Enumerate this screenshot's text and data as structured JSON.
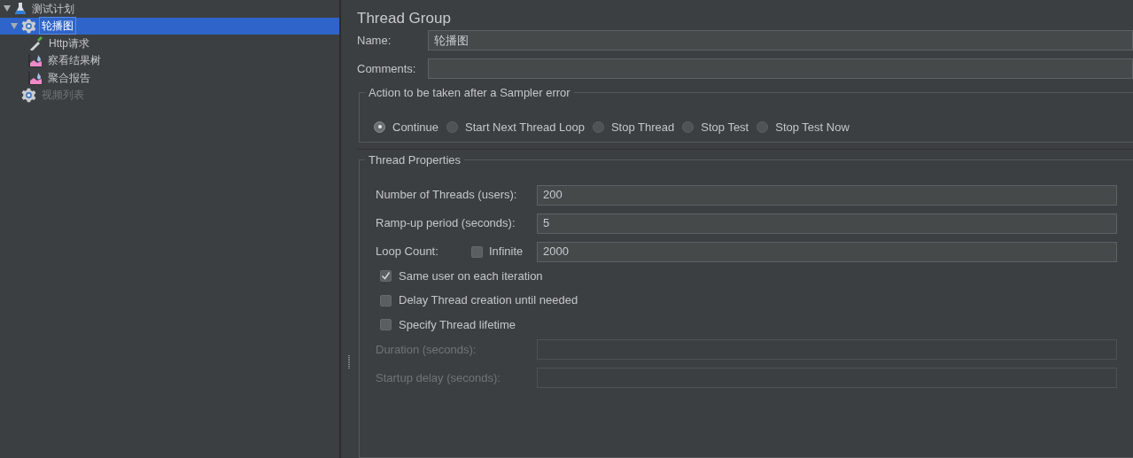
{
  "tree": [
    {
      "label": "测试计划",
      "kind": "flask",
      "expanded": true,
      "selected": false,
      "disabled": false,
      "children": [
        {
          "label": "轮播图",
          "kind": "gear",
          "expanded": true,
          "selected": true,
          "disabled": false,
          "children": [
            {
              "label": "Http请求",
              "kind": "sampler",
              "selected": false,
              "disabled": false
            },
            {
              "label": "察看结果树",
              "kind": "listener",
              "selected": false,
              "disabled": false
            },
            {
              "label": "聚合报告",
              "kind": "listener",
              "selected": false,
              "disabled": false
            }
          ]
        },
        {
          "label": "视频列表",
          "kind": "gear",
          "selected": false,
          "disabled": true
        }
      ]
    }
  ],
  "title": "Thread Group",
  "name_field": {
    "label": "Name:",
    "value": "轮播图"
  },
  "comments_field": {
    "label": "Comments:"
  },
  "sampler_error": {
    "title": "Action to be taken after a Sampler error",
    "options": [
      {
        "label": "Continue",
        "selected": true
      },
      {
        "label": "Start Next Thread Loop",
        "selected": false
      },
      {
        "label": "Stop Thread",
        "selected": false
      },
      {
        "label": "Stop Test",
        "selected": false
      },
      {
        "label": "Stop Test Now",
        "selected": false
      }
    ]
  },
  "thread_properties": {
    "title": "Thread Properties",
    "rows": [
      {
        "kind": "field",
        "label": "Number of Threads (users):",
        "value": "200",
        "disabled": false
      },
      {
        "kind": "field",
        "label": "Ramp-up period (seconds):",
        "value": "5",
        "disabled": false
      },
      {
        "kind": "loop",
        "label": "Loop Count:",
        "checkbox": {
          "label": "Infinite",
          "checked": false
        },
        "value": "2000"
      },
      {
        "kind": "checkbox",
        "label": "Same user on each iteration",
        "checked": true
      },
      {
        "kind": "checkbox",
        "label": "Delay Thread creation until needed",
        "checked": false
      },
      {
        "kind": "checkbox",
        "label": "Specify Thread lifetime",
        "checked": false
      },
      {
        "kind": "field",
        "label": "Duration (seconds):",
        "disabled": true
      },
      {
        "kind": "field",
        "label": "Startup delay (seconds):",
        "disabled": true
      }
    ]
  }
}
